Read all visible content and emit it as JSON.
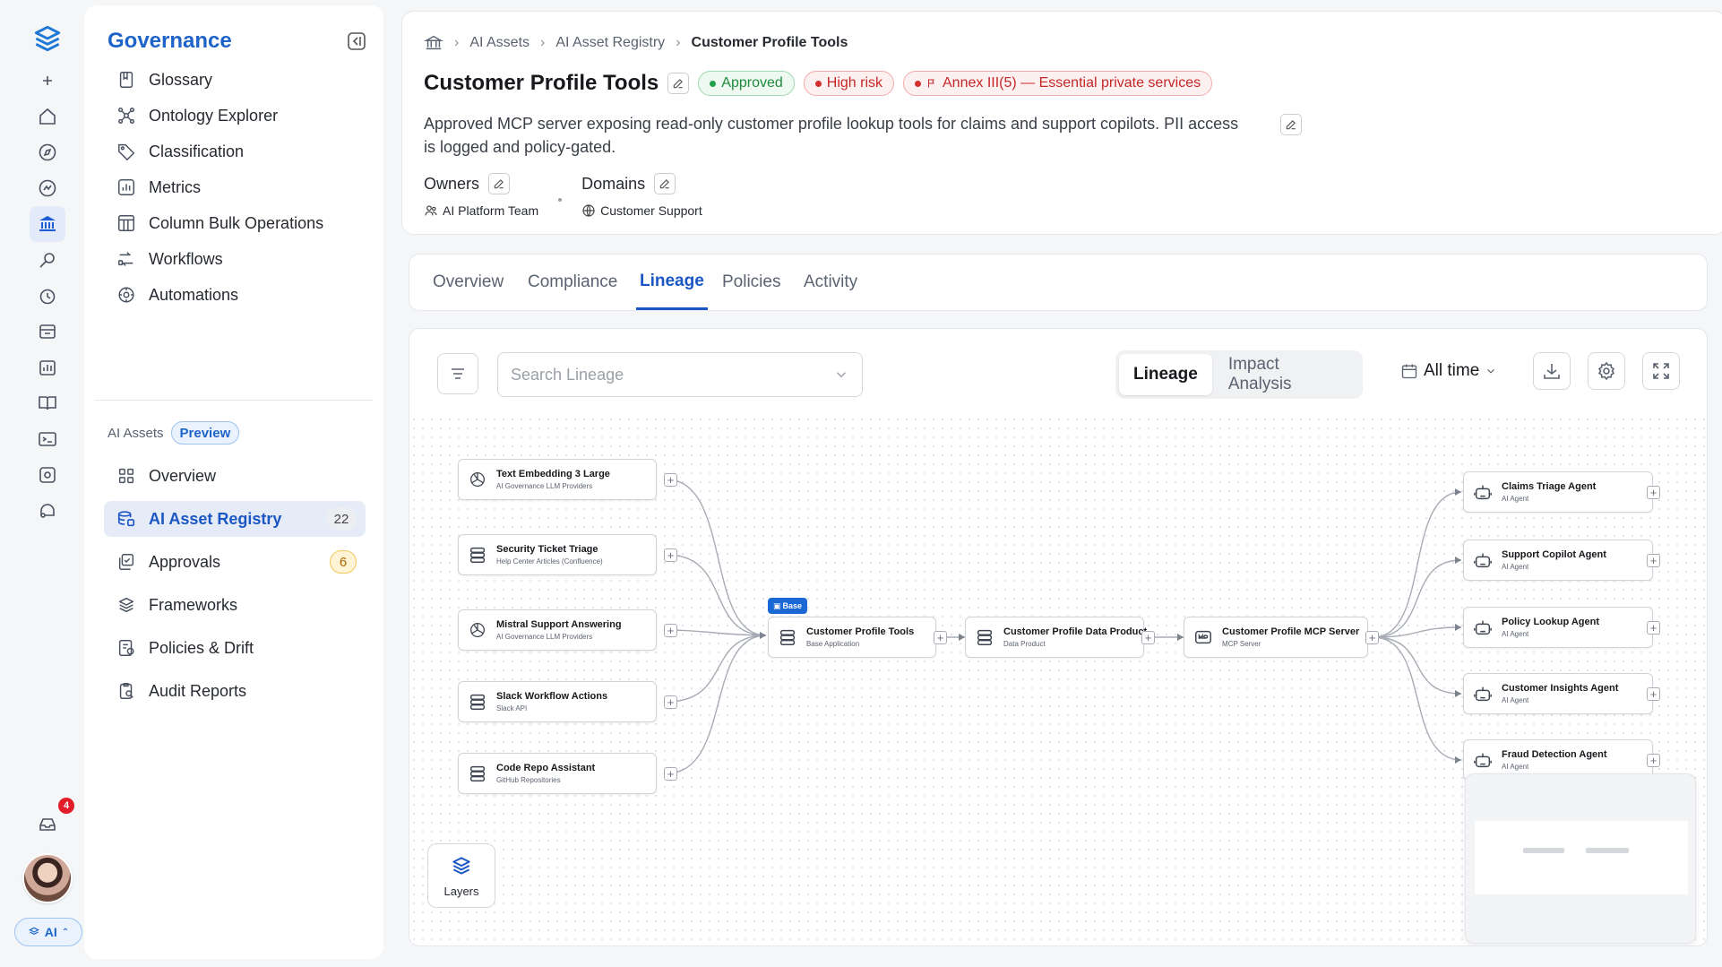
{
  "rail": {
    "notification_count": "4",
    "ai_label": "AI"
  },
  "sidenav": {
    "title": "Governance",
    "items": [
      {
        "label": "Glossary",
        "icon": "book-icon"
      },
      {
        "label": "Ontology Explorer",
        "icon": "graph-icon"
      },
      {
        "label": "Classification",
        "icon": "tag-icon"
      },
      {
        "label": "Metrics",
        "icon": "chart-icon"
      },
      {
        "label": "Column Bulk Operations",
        "icon": "table-icon"
      },
      {
        "label": "Workflows",
        "icon": "workflow-icon"
      },
      {
        "label": "Automations",
        "icon": "automation-icon"
      }
    ],
    "section_label": "AI Assets",
    "section_badge": "Preview",
    "ai_items": [
      {
        "label": "Overview",
        "icon": "grid-icon",
        "count": ""
      },
      {
        "label": "AI Asset Registry",
        "icon": "database-icon",
        "count": "22"
      },
      {
        "label": "Approvals",
        "icon": "approval-icon",
        "count": "6"
      },
      {
        "label": "Frameworks",
        "icon": "layers-icon",
        "count": ""
      },
      {
        "label": "Policies & Drift",
        "icon": "policy-icon",
        "count": ""
      },
      {
        "label": "Audit Reports",
        "icon": "audit-icon",
        "count": ""
      }
    ]
  },
  "header": {
    "breadcrumb": [
      "AI Assets",
      "AI Asset Registry",
      "Customer Profile Tools"
    ],
    "title": "Customer Profile Tools",
    "tags": {
      "status": "Approved",
      "risk": "High risk",
      "annex": "Annex III(5) — Essential private services"
    },
    "description": "Approved MCP server exposing read‑only customer profile lookup tools for claims and support copilots. PII access is logged and policy‑gated.",
    "owners_label": "Owners",
    "owners_value": "AI Platform Team",
    "domains_label": "Domains",
    "domains_value": "Customer Support"
  },
  "tabs": [
    "Overview",
    "Compliance",
    "Lineage",
    "Policies",
    "Activity"
  ],
  "lineage": {
    "search_placeholder": "Search Lineage",
    "mode_lineage": "Lineage",
    "mode_impact": "Impact Analysis",
    "time_filter": "All time",
    "base_label": "Base",
    "layers_label": "Layers",
    "sources": [
      {
        "name": "Text Embedding 3 Large",
        "sub": "AI Governance LLM Providers",
        "icon": "openai-icon"
      },
      {
        "name": "Security Ticket Triage",
        "sub": "Help Center Articles (Confluence)",
        "icon": "database-icon"
      },
      {
        "name": "Mistral Support Answering",
        "sub": "AI Governance LLM Providers",
        "icon": "openai-icon"
      },
      {
        "name": "Slack Workflow Actions",
        "sub": "Slack API",
        "icon": "database-icon"
      },
      {
        "name": "Code Repo Assistant",
        "sub": "GitHub Repositories",
        "icon": "database-icon"
      }
    ],
    "center": [
      {
        "name": "Customer Profile Tools",
        "sub": "Base Application",
        "icon": "database-icon"
      },
      {
        "name": "Customer Profile Data Product",
        "sub": "Data Product",
        "icon": "database-icon"
      },
      {
        "name": "Customer Profile MCP Server",
        "sub": "MCP Server",
        "icon": "mcp-icon"
      }
    ],
    "targets": [
      {
        "name": "Claims Triage Agent",
        "sub": "AI Agent",
        "icon": "robot-icon"
      },
      {
        "name": "Support Copilot Agent",
        "sub": "AI Agent",
        "icon": "robot-icon"
      },
      {
        "name": "Policy Lookup Agent",
        "sub": "AI Agent",
        "icon": "robot-icon"
      },
      {
        "name": "Customer Insights Agent",
        "sub": "AI Agent",
        "icon": "robot-icon"
      },
      {
        "name": "Fraud Detection Agent",
        "sub": "AI Agent",
        "icon": "robot-icon"
      }
    ]
  },
  "colors": {
    "accent": "#1a56c4",
    "approved": "#1f8a3c",
    "risk": "#c62828"
  }
}
